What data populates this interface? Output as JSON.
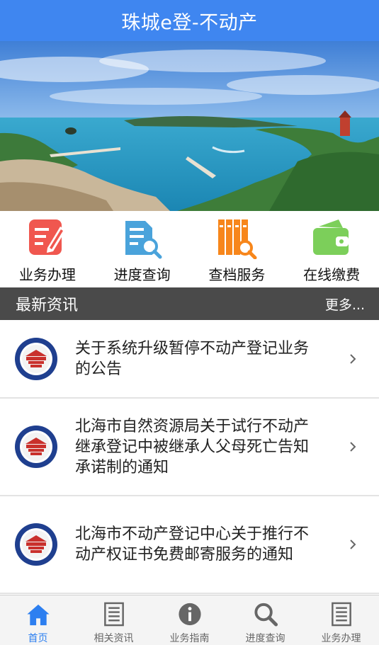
{
  "header": {
    "title": "珠城e登-不动产"
  },
  "banner": {
    "slides": 3,
    "active_slide": 1
  },
  "quick_links": [
    {
      "label": "业务办理",
      "icon": "edit-form-icon",
      "color": "#f0574f"
    },
    {
      "label": "进度查询",
      "icon": "document-search-icon",
      "color": "#4aa3db"
    },
    {
      "label": "查档服务",
      "icon": "archive-search-icon",
      "color": "#f7861b"
    },
    {
      "label": "在线缴费",
      "icon": "wallet-icon",
      "color": "#7ccf5a"
    }
  ],
  "news": {
    "title": "最新资讯",
    "more": "更多...",
    "items": [
      {
        "title": "关于系统升级暂停不动产登记业务的公告"
      },
      {
        "title": "北海市自然资源局关于试行不动产继承登记中被继承人父母死亡告知承诺制的通知"
      },
      {
        "title": "北海市不动产登记中心关于推行不动产权证书免费邮寄服务的通知"
      }
    ]
  },
  "tabbar": {
    "active_color": "#2d7ff0",
    "items": [
      {
        "label": "首页",
        "icon": "home-icon",
        "active": true
      },
      {
        "label": "相关资讯",
        "icon": "document-list-icon",
        "active": false
      },
      {
        "label": "业务指南",
        "icon": "info-icon",
        "active": false
      },
      {
        "label": "进度查询",
        "icon": "search-icon",
        "active": false
      },
      {
        "label": "业务办理",
        "icon": "document-list-icon",
        "active": false
      }
    ]
  }
}
